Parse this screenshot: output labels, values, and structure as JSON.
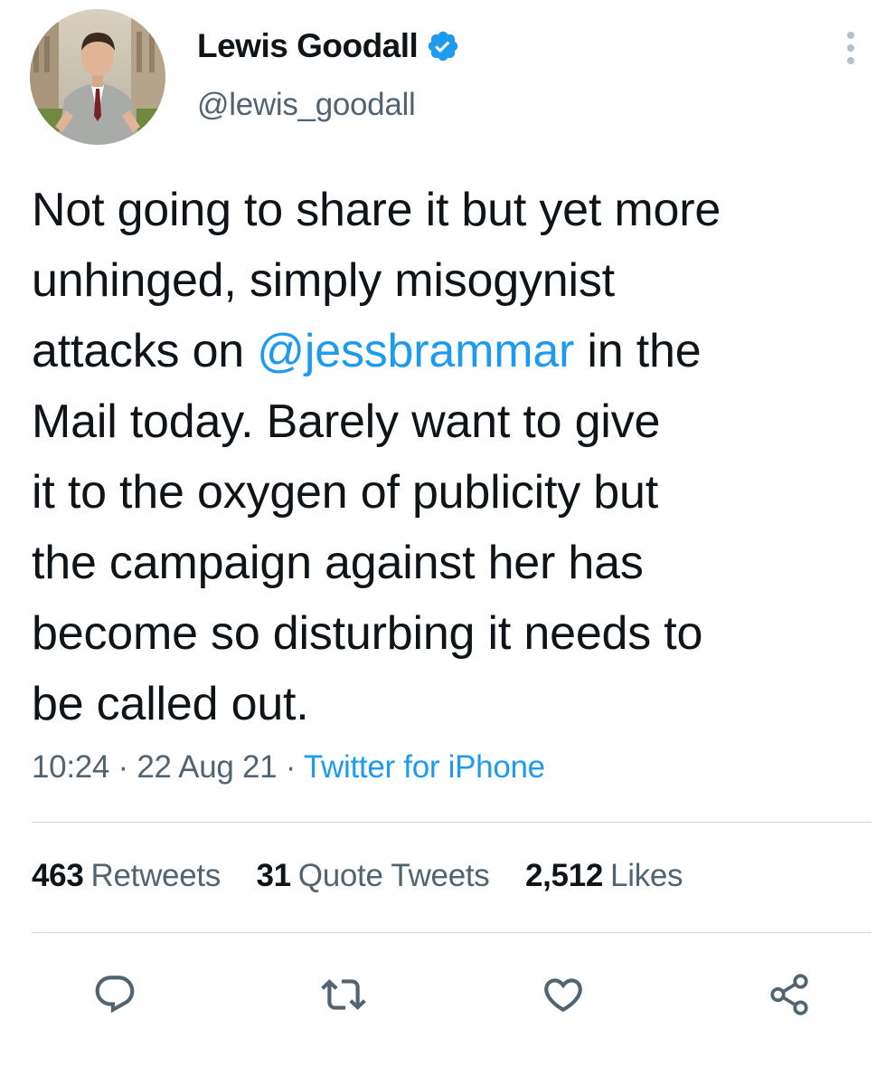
{
  "author": {
    "display_name": "Lewis Goodall",
    "handle": "@lewis_goodall",
    "verified": true,
    "avatar_icon": "profile-photo"
  },
  "header": {
    "more_icon": "vertical-ellipsis-icon"
  },
  "tweet": {
    "lines": [
      {
        "text": "Not going to share it but yet more"
      },
      {
        "text": "unhinged, simply misogynist"
      },
      {
        "before": "attacks on ",
        "mention": "@jessbrammar",
        "after": " in the"
      },
      {
        "text": "Mail today. Barely want to give"
      },
      {
        "text": "it to the oxygen of publicity but"
      },
      {
        "text": "the campaign against her has"
      },
      {
        "text": "become so disturbing it needs to"
      },
      {
        "text": "be called out."
      }
    ],
    "time": "10:24",
    "separator": "·",
    "date": "22 Aug 21",
    "source": "Twitter for iPhone"
  },
  "stats": {
    "retweets": {
      "count": "463",
      "label": "Retweets"
    },
    "quotes": {
      "count": "31",
      "label": "Quote Tweets"
    },
    "likes": {
      "count": "2,512",
      "label": "Likes"
    }
  },
  "actions": [
    "reply-icon",
    "retweet-icon",
    "like-icon",
    "share-icon"
  ],
  "colors": {
    "accent": "#1d9bf0",
    "text_primary": "#0f1419",
    "text_secondary": "#536471",
    "divider": "#cfd9de"
  }
}
